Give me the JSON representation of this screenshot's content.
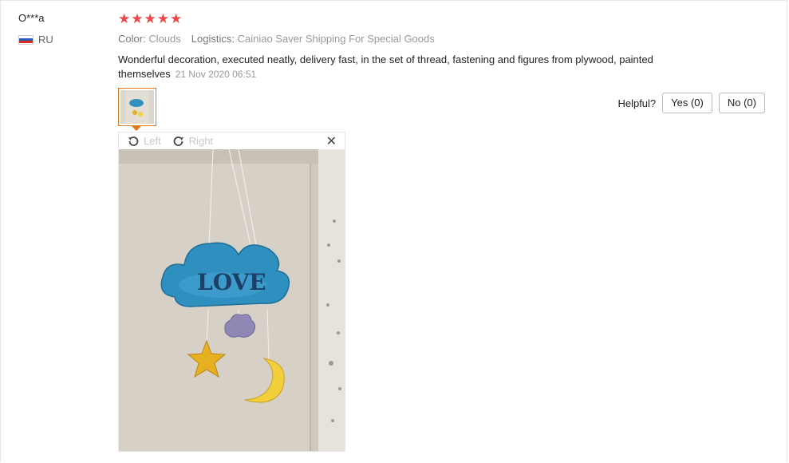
{
  "user": {
    "name": "O***a",
    "country": "RU"
  },
  "review": {
    "stars": [
      "★",
      "★",
      "★",
      "★",
      "★"
    ],
    "color_label": "Color:",
    "color_value": "Clouds",
    "logistics_label": "Logistics:",
    "logistics_value": "Cainiao Saver Shipping For Special Goods",
    "text": "Wonderful decoration, executed neatly, delivery fast, in the set of thread, fastening and figures from plywood, painted themselves",
    "date": "21 Nov 2020 06:51"
  },
  "helpful": {
    "label": "Helpful?",
    "yes": "Yes (0)",
    "no": "No (0)"
  },
  "viewer": {
    "rotate_left": "Left",
    "rotate_right": "Right",
    "close": "✕"
  },
  "photo": {
    "sign_text": "LOVE"
  },
  "colors": {
    "star": "#f0474b",
    "thumb_border": "#e07a1c",
    "cloud": "#2f8fbf",
    "moon": "#f2cf3b",
    "star_figure": "#e6b020",
    "small_cloud": "#8f88b5"
  }
}
